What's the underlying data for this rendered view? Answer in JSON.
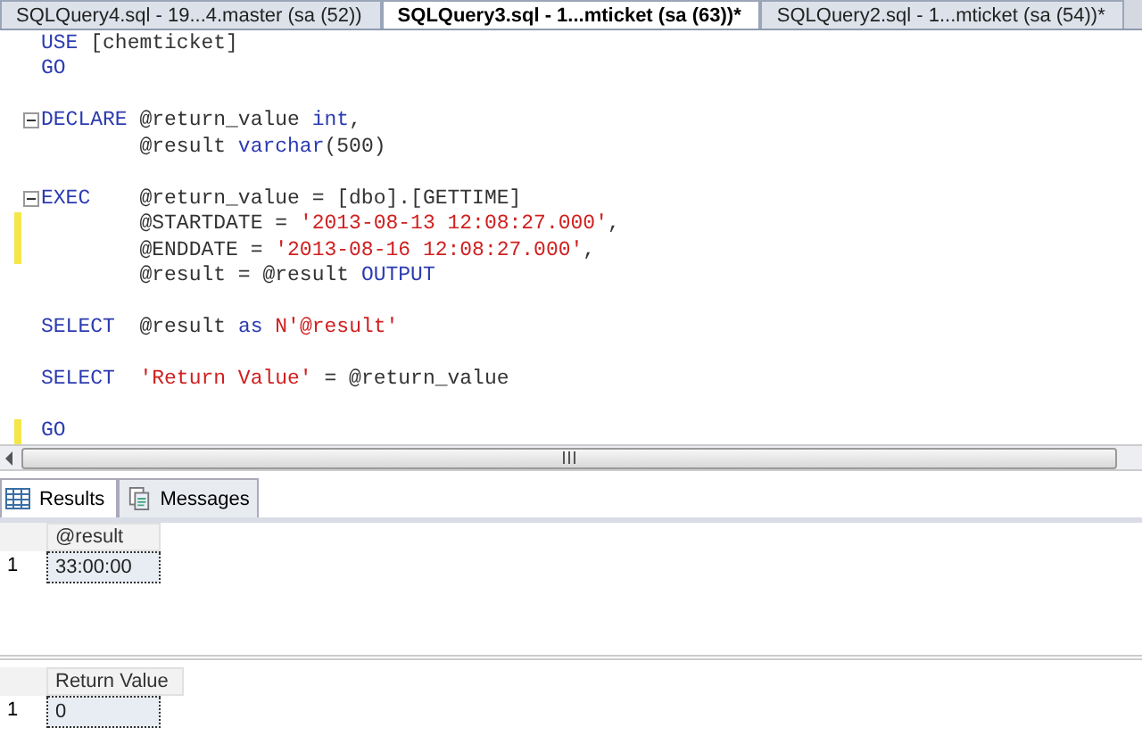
{
  "doc_tabs": [
    {
      "label": "SQLQuery4.sql - 19...4.master (sa (52))",
      "selected": false
    },
    {
      "label": "SQLQuery3.sql - 1...mticket (sa (63))*",
      "selected": true
    },
    {
      "label": "SQLQuery2.sql - 1...mticket (sa (54))*",
      "selected": false
    }
  ],
  "code_lines": [
    {
      "fold": false,
      "changed": false,
      "tokens": [
        {
          "kind": "keyword",
          "text": "USE"
        },
        {
          "kind": "plain",
          "text": " [chemticket]"
        }
      ]
    },
    {
      "fold": false,
      "changed": false,
      "tokens": [
        {
          "kind": "keyword",
          "text": "GO"
        }
      ]
    },
    {
      "fold": false,
      "changed": false
    },
    {
      "fold": true,
      "changed": false,
      "tokens": [
        {
          "kind": "keyword",
          "text": "DECLARE"
        },
        {
          "kind": "plain",
          "text": " @return_value "
        },
        {
          "kind": "keyword",
          "text": "int"
        },
        {
          "kind": "plain",
          "text": ","
        }
      ]
    },
    {
      "fold": false,
      "changed": false,
      "tokens": [
        {
          "kind": "plain",
          "text": "        @result "
        },
        {
          "kind": "keyword",
          "text": "varchar"
        },
        {
          "kind": "plain",
          "text": "(500)"
        }
      ]
    },
    {
      "fold": false,
      "changed": false
    },
    {
      "fold": true,
      "changed": false,
      "tokens": [
        {
          "kind": "keyword",
          "text": "EXEC"
        },
        {
          "kind": "plain",
          "text": "    @return_value = [dbo].[GETTIME]"
        }
      ]
    },
    {
      "fold": false,
      "changed": true,
      "tokens": [
        {
          "kind": "plain",
          "text": "        @STARTDATE = "
        },
        {
          "kind": "string",
          "text": "'2013-08-13 12:08:27.000'"
        },
        {
          "kind": "plain",
          "text": ","
        }
      ]
    },
    {
      "fold": false,
      "changed": true,
      "tokens": [
        {
          "kind": "plain",
          "text": "        @ENDDATE = "
        },
        {
          "kind": "string",
          "text": "'2013-08-16 12:08:27.000'"
        },
        {
          "kind": "plain",
          "text": ","
        }
      ]
    },
    {
      "fold": false,
      "changed": false,
      "tokens": [
        {
          "kind": "plain",
          "text": "        @result = @result "
        },
        {
          "kind": "keyword",
          "text": "OUTPUT"
        }
      ]
    },
    {
      "fold": false,
      "changed": false
    },
    {
      "fold": false,
      "changed": false,
      "tokens": [
        {
          "kind": "keyword",
          "text": "SELECT"
        },
        {
          "kind": "plain",
          "text": "  @result "
        },
        {
          "kind": "keyword",
          "text": "as "
        },
        {
          "kind": "string",
          "text": "N'@result'"
        }
      ]
    },
    {
      "fold": false,
      "changed": false
    },
    {
      "fold": false,
      "changed": false,
      "tokens": [
        {
          "kind": "keyword",
          "text": "SELECT  "
        },
        {
          "kind": "string",
          "text": "'Return Value'"
        },
        {
          "kind": "plain",
          "text": " = @return_value"
        }
      ]
    },
    {
      "fold": false,
      "changed": false
    },
    {
      "fold": false,
      "changed": true,
      "tokens": [
        {
          "kind": "keyword",
          "text": "GO"
        }
      ]
    }
  ],
  "result_tabs": [
    {
      "kind": "grid",
      "label": "Results",
      "selected": true
    },
    {
      "kind": "messages",
      "label": "Messages",
      "selected": false
    }
  ],
  "grids": [
    {
      "column": "@result",
      "rows": [
        {
          "number": "1",
          "value": "33:00:00"
        }
      ]
    },
    {
      "column": "Return Value",
      "rows": [
        {
          "number": "1",
          "value": "0"
        }
      ]
    }
  ]
}
